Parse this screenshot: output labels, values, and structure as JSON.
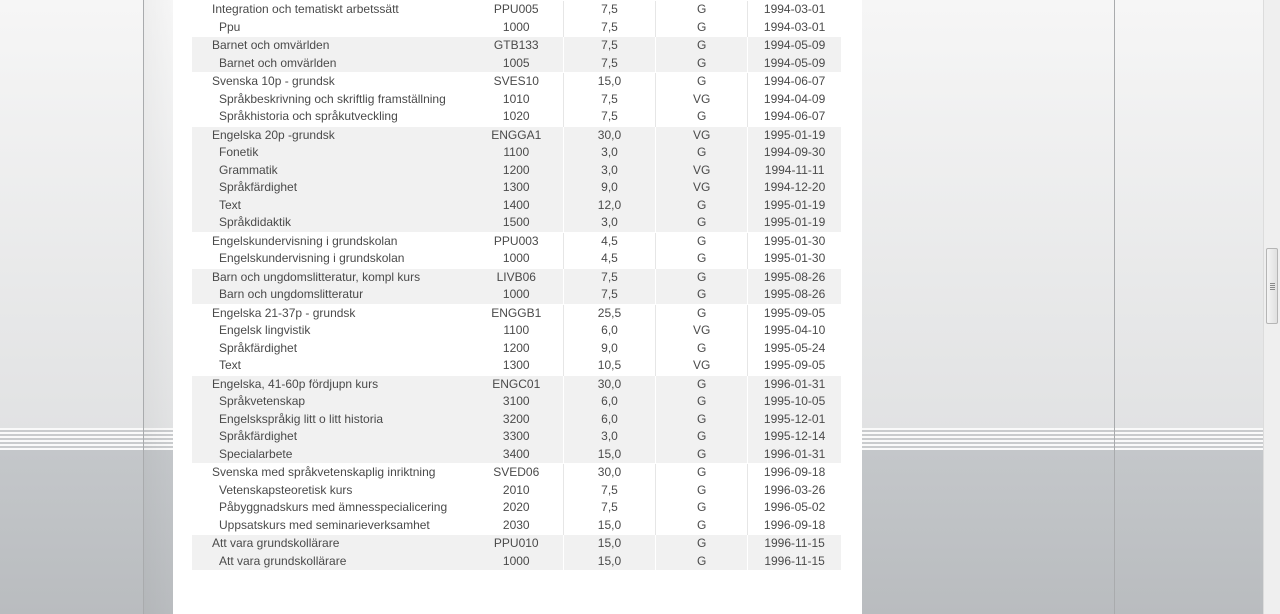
{
  "colors": {
    "row_grey": "#f1f1f1",
    "row_white": "#ffffff",
    "text": "#4a4a4a"
  },
  "courses": [
    {
      "group": "white",
      "main": true,
      "name": "Integration och tematiskt arbetssätt",
      "code": "PPU005",
      "points": "7,5",
      "grade": "G",
      "date": "1994-03-01"
    },
    {
      "group": "white",
      "main": false,
      "name": "Ppu",
      "code": "1000",
      "points": "7,5",
      "grade": "G",
      "date": "1994-03-01"
    },
    {
      "group": "grey",
      "main": true,
      "name": "Barnet och omvärlden",
      "code": "GTB133",
      "points": "7,5",
      "grade": "G",
      "date": "1994-05-09"
    },
    {
      "group": "grey",
      "main": false,
      "name": "Barnet och omvärlden",
      "code": "1005",
      "points": "7,5",
      "grade": "G",
      "date": "1994-05-09"
    },
    {
      "group": "white",
      "main": true,
      "name": "Svenska 10p - grundsk",
      "code": "SVES10",
      "points": "15,0",
      "grade": "G",
      "date": "1994-06-07"
    },
    {
      "group": "white",
      "main": false,
      "name": "Språkbeskrivning och skriftlig framställning",
      "code": "1010",
      "points": "7,5",
      "grade": "VG",
      "date": "1994-04-09"
    },
    {
      "group": "white",
      "main": false,
      "name": "Språkhistoria och språkutveckling",
      "code": "1020",
      "points": "7,5",
      "grade": "G",
      "date": "1994-06-07"
    },
    {
      "group": "grey",
      "main": true,
      "name": "Engelska 20p -grundsk",
      "code": "ENGGA1",
      "points": "30,0",
      "grade": "VG",
      "date": "1995-01-19"
    },
    {
      "group": "grey",
      "main": false,
      "name": "Fonetik",
      "code": "1100",
      "points": "3,0",
      "grade": "G",
      "date": "1994-09-30"
    },
    {
      "group": "grey",
      "main": false,
      "name": "Grammatik",
      "code": "1200",
      "points": "3,0",
      "grade": "VG",
      "date": "1994-11-11"
    },
    {
      "group": "grey",
      "main": false,
      "name": "Språkfärdighet",
      "code": "1300",
      "points": "9,0",
      "grade": "VG",
      "date": "1994-12-20"
    },
    {
      "group": "grey",
      "main": false,
      "name": "Text",
      "code": "1400",
      "points": "12,0",
      "grade": "G",
      "date": "1995-01-19"
    },
    {
      "group": "grey",
      "main": false,
      "name": "Språkdidaktik",
      "code": "1500",
      "points": "3,0",
      "grade": "G",
      "date": "1995-01-19"
    },
    {
      "group": "white",
      "main": true,
      "name": "Engelskundervisning i grundskolan",
      "code": "PPU003",
      "points": "4,5",
      "grade": "G",
      "date": "1995-01-30"
    },
    {
      "group": "white",
      "main": false,
      "name": "Engelskundervisning i grundskolan",
      "code": "1000",
      "points": "4,5",
      "grade": "G",
      "date": "1995-01-30"
    },
    {
      "group": "grey",
      "main": true,
      "name": "Barn och ungdomslitteratur, kompl kurs",
      "code": "LIVB06",
      "points": "7,5",
      "grade": "G",
      "date": "1995-08-26"
    },
    {
      "group": "grey",
      "main": false,
      "name": "Barn och ungdomslitteratur",
      "code": "1000",
      "points": "7,5",
      "grade": "G",
      "date": "1995-08-26"
    },
    {
      "group": "white",
      "main": true,
      "name": "Engelska 21-37p - grundsk",
      "code": "ENGGB1",
      "points": "25,5",
      "grade": "G",
      "date": "1995-09-05"
    },
    {
      "group": "white",
      "main": false,
      "name": "Engelsk lingvistik",
      "code": "1100",
      "points": "6,0",
      "grade": "VG",
      "date": "1995-04-10"
    },
    {
      "group": "white",
      "main": false,
      "name": "Språkfärdighet",
      "code": "1200",
      "points": "9,0",
      "grade": "G",
      "date": "1995-05-24"
    },
    {
      "group": "white",
      "main": false,
      "name": "Text",
      "code": "1300",
      "points": "10,5",
      "grade": "VG",
      "date": "1995-09-05"
    },
    {
      "group": "grey",
      "main": true,
      "name": "Engelska, 41-60p fördjupn kurs",
      "code": "ENGC01",
      "points": "30,0",
      "grade": "G",
      "date": "1996-01-31"
    },
    {
      "group": "grey",
      "main": false,
      "name": "Språkvetenskap",
      "code": "3100",
      "points": "6,0",
      "grade": "G",
      "date": "1995-10-05"
    },
    {
      "group": "grey",
      "main": false,
      "name": "Engelskspråkig litt o litt historia",
      "code": "3200",
      "points": "6,0",
      "grade": "G",
      "date": "1995-12-01"
    },
    {
      "group": "grey",
      "main": false,
      "name": "Språkfärdighet",
      "code": "3300",
      "points": "3,0",
      "grade": "G",
      "date": "1995-12-14"
    },
    {
      "group": "grey",
      "main": false,
      "name": "Specialarbete",
      "code": "3400",
      "points": "15,0",
      "grade": "G",
      "date": "1996-01-31"
    },
    {
      "group": "white",
      "main": true,
      "name": "Svenska med språkvetenskaplig inriktning",
      "code": "SVED06",
      "points": "30,0",
      "grade": "G",
      "date": "1996-09-18"
    },
    {
      "group": "white",
      "main": false,
      "name": "Vetenskapsteoretisk kurs",
      "code": "2010",
      "points": "7,5",
      "grade": "G",
      "date": "1996-03-26"
    },
    {
      "group": "white",
      "main": false,
      "name": "Påbyggnadskurs med ämnesspecialicering",
      "code": "2020",
      "points": "7,5",
      "grade": "G",
      "date": "1996-05-02"
    },
    {
      "group": "white",
      "main": false,
      "name": "Uppsatskurs med seminarieverksamhet",
      "code": "2030",
      "points": "15,0",
      "grade": "G",
      "date": "1996-09-18"
    },
    {
      "group": "grey",
      "main": true,
      "name": "Att vara grundskollärare",
      "code": "PPU010",
      "points": "15,0",
      "grade": "G",
      "date": "1996-11-15"
    },
    {
      "group": "grey",
      "main": false,
      "name": "Att vara grundskollärare",
      "code": "1000",
      "points": "15,0",
      "grade": "G",
      "date": "1996-11-15"
    }
  ]
}
